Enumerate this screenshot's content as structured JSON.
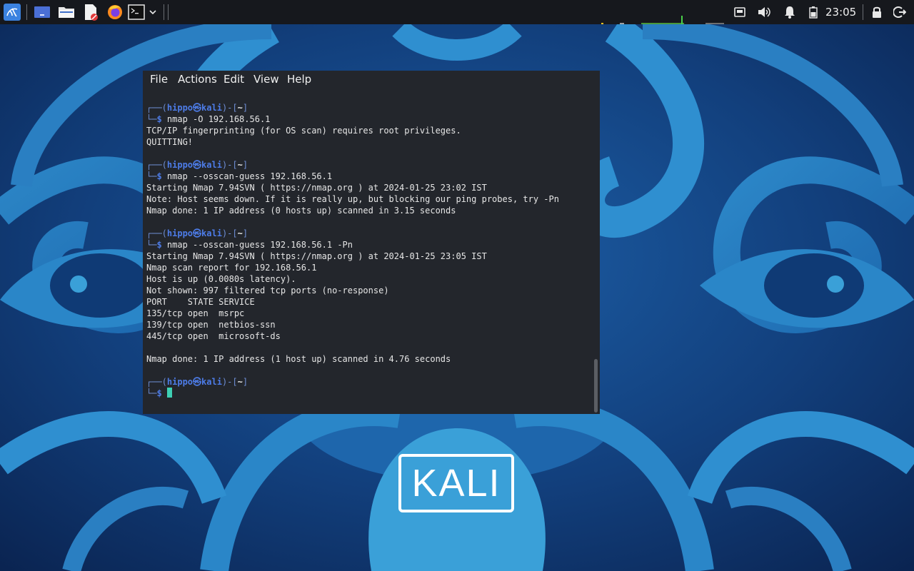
{
  "colors": {
    "wallpaper_dark": "#0d2c5a",
    "wallpaper_light": "#3aa0d8",
    "taskbar_bg": "#16181d",
    "terminal_bg": "#23262c",
    "prompt_blue": "#4d7ce8",
    "cursor_teal": "#3ecfb4"
  },
  "taskbar": {
    "launchers": [
      {
        "name": "kali-menu-icon"
      },
      {
        "name": "show-desktop-icon"
      },
      {
        "name": "file-manager-icon"
      },
      {
        "name": "text-editor-icon"
      },
      {
        "name": "firefox-icon"
      },
      {
        "name": "terminal-icon"
      },
      {
        "name": "chevron-down-icon"
      }
    ],
    "tray": [
      "network-icon",
      "volume-icon",
      "notification-bell-icon",
      "battery-icon",
      "lock-icon",
      "logout-icon"
    ],
    "clock": "23:05"
  },
  "terminal": {
    "menu": [
      "File",
      "Actions",
      "Edit",
      "View",
      "Help"
    ],
    "prompt": {
      "user": "hippo",
      "at": "㉿",
      "host": "kali",
      "dir": "~",
      "symbol": "$"
    },
    "lines": [
      {
        "type": "prompt-top"
      },
      {
        "type": "prompt-cmd",
        "text": "nmap -O 192.168.56.1"
      },
      {
        "type": "out",
        "text": "TCP/IP fingerprinting (for OS scan) requires root privileges."
      },
      {
        "type": "out",
        "text": "QUITTING!"
      },
      {
        "type": "blank"
      },
      {
        "type": "prompt-top"
      },
      {
        "type": "prompt-cmd",
        "text": "nmap --osscan-guess 192.168.56.1"
      },
      {
        "type": "out",
        "text": "Starting Nmap 7.94SVN ( https://nmap.org ) at 2024-01-25 23:02 IST"
      },
      {
        "type": "out",
        "text": "Note: Host seems down. If it is really up, but blocking our ping probes, try -Pn"
      },
      {
        "type": "out",
        "text": "Nmap done: 1 IP address (0 hosts up) scanned in 3.15 seconds"
      },
      {
        "type": "blank"
      },
      {
        "type": "prompt-top"
      },
      {
        "type": "prompt-cmd",
        "text": "nmap --osscan-guess 192.168.56.1 -Pn"
      },
      {
        "type": "out",
        "text": "Starting Nmap 7.94SVN ( https://nmap.org ) at 2024-01-25 23:05 IST"
      },
      {
        "type": "out",
        "text": "Nmap scan report for 192.168.56.1"
      },
      {
        "type": "out",
        "text": "Host is up (0.0080s latency)."
      },
      {
        "type": "out",
        "text": "Not shown: 997 filtered tcp ports (no-response)"
      },
      {
        "type": "out",
        "text": "PORT    STATE SERVICE"
      },
      {
        "type": "out",
        "text": "135/tcp open  msrpc"
      },
      {
        "type": "out",
        "text": "139/tcp open  netbios-ssn"
      },
      {
        "type": "out",
        "text": "445/tcp open  microsoft-ds"
      },
      {
        "type": "blank"
      },
      {
        "type": "out",
        "text": "Nmap done: 1 IP address (1 host up) scanned in 4.76 seconds"
      },
      {
        "type": "blank"
      },
      {
        "type": "prompt-top"
      },
      {
        "type": "prompt-cursor"
      }
    ]
  },
  "desktop": {
    "logo_text": "KALI"
  }
}
